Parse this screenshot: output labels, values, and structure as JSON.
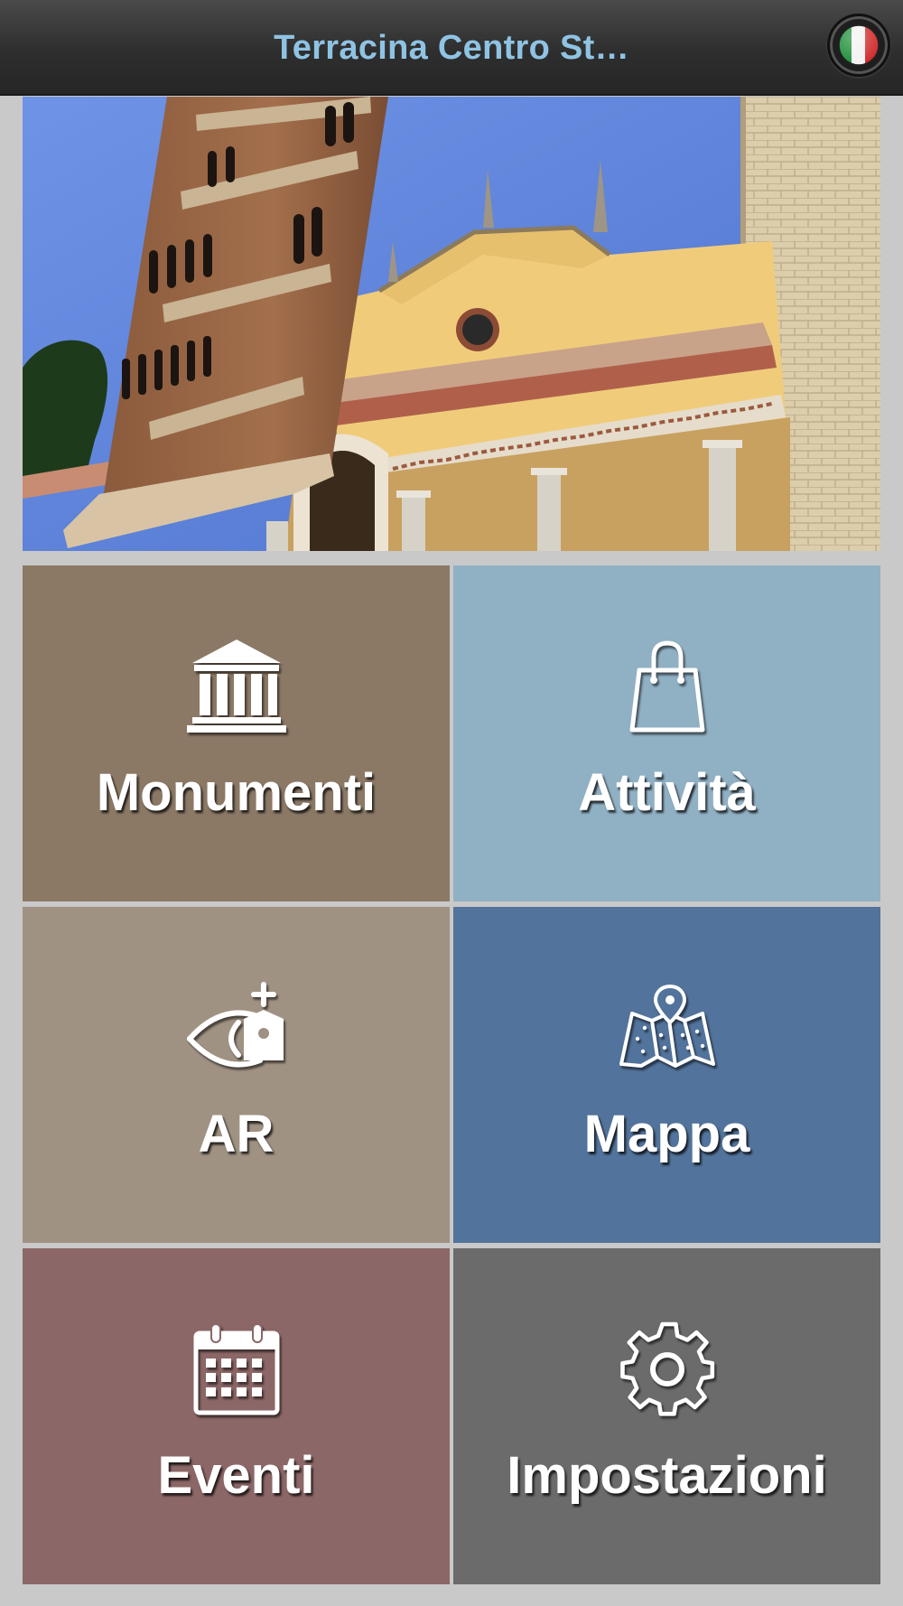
{
  "header": {
    "title": "Terracina Centro St…",
    "language_flag": "italy-flag-icon"
  },
  "hero": {
    "subject": "cathedral-bell-tower-photo"
  },
  "tiles": [
    {
      "label": "Monumenti",
      "icon": "museum-icon",
      "color": "#8b7966"
    },
    {
      "label": "Attività",
      "icon": "shopping-bag-icon",
      "color": "#90b0c4"
    },
    {
      "label": "AR",
      "icon": "ar-eye-tag-icon",
      "color": "#a09283"
    },
    {
      "label": "Mappa",
      "icon": "map-icon",
      "color": "#52739b"
    },
    {
      "label": "Eventi",
      "icon": "calendar-icon",
      "color": "#8c6767"
    },
    {
      "label": "Impostazioni",
      "icon": "gear-icon",
      "color": "#6b6b6b"
    }
  ]
}
